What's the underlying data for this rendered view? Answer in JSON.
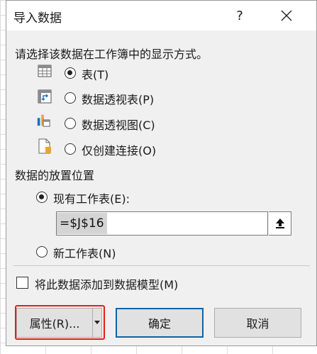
{
  "dialog": {
    "title": "导入数据",
    "help_label": "?",
    "close_icon": "close-icon"
  },
  "display": {
    "prompt": "请选择该数据在工作簿中的显示方式。",
    "options": [
      {
        "label": "表(T)",
        "icon": "table-icon",
        "checked": true
      },
      {
        "label": "数据透视表(P)",
        "icon": "pivot-table-icon",
        "checked": false
      },
      {
        "label": "数据透视图(C)",
        "icon": "pivot-chart-icon",
        "checked": false
      },
      {
        "label": "仅创建连接(O)",
        "icon": "connection-only-icon",
        "checked": false
      }
    ]
  },
  "placement": {
    "heading": "数据的放置位置",
    "existing_label": "现有工作表(E):",
    "existing_checked": true,
    "reference_value": "=$J$16",
    "new_label": "新工作表(N)",
    "new_checked": false
  },
  "data_model": {
    "label": "将此数据添加到数据模型(M)",
    "checked": false
  },
  "buttons": {
    "properties": "属性(R)...",
    "ok": "确定",
    "cancel": "取消"
  },
  "colors": {
    "highlight": "#e0201a",
    "default_button_border": "#0a64ad"
  }
}
